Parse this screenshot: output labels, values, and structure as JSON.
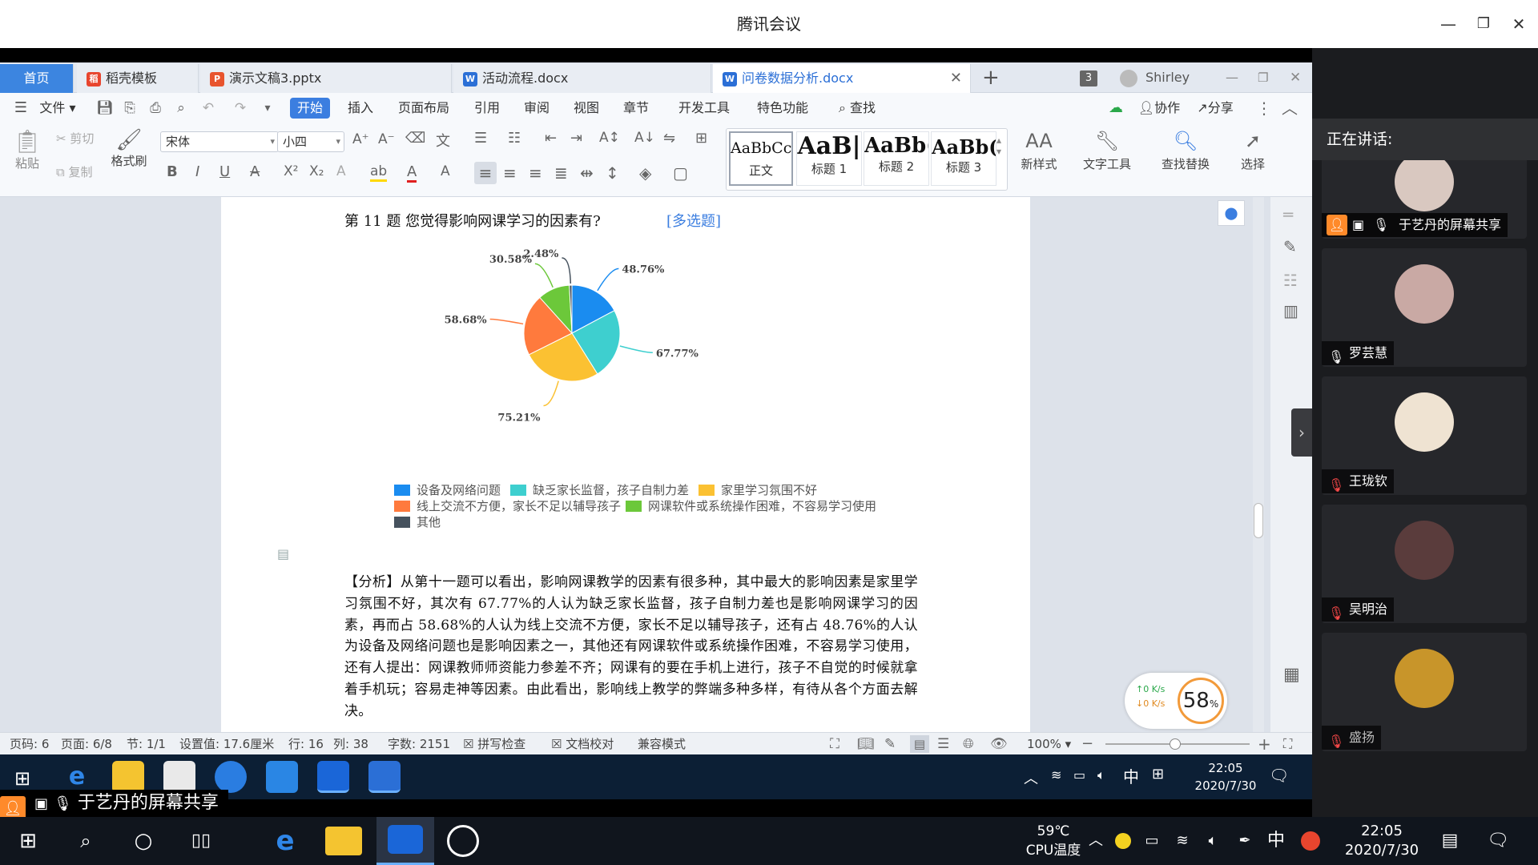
{
  "meeting": {
    "title": "腾讯会议",
    "sharer_label": "于艺丹的屏幕共享",
    "speaking_label": "正在讲话:"
  },
  "wps": {
    "tabs": [
      {
        "label": "首页"
      },
      {
        "label": "稻壳模板",
        "icon": "docer-icon",
        "color": "#e8452e"
      },
      {
        "label": "演示文稿3.pptx",
        "icon": "ppt-icon",
        "color": "#e8542e"
      },
      {
        "label": "活动流程.docx",
        "icon": "word-icon",
        "color": "#2b6fd6"
      },
      {
        "label": "问卷数据分析.docx",
        "icon": "word-icon",
        "color": "#2b6fd6"
      }
    ],
    "tab_count": "3",
    "user": "Shirley",
    "menu": [
      "文件",
      "开始",
      "插入",
      "页面布局",
      "引用",
      "审阅",
      "视图",
      "章节",
      "开发工具",
      "特色功能",
      "查找"
    ],
    "menu_right": [
      "协作",
      "分享"
    ],
    "ribbon": {
      "paste": "粘贴",
      "cut": "剪切",
      "copy": "复制",
      "format_painter": "格式刷",
      "font": "宋体",
      "size": "小四",
      "styles": [
        {
          "sample": "AaBbCcI",
          "label": "正文"
        },
        {
          "sample": "AaB|",
          "label": "标题 1"
        },
        {
          "sample": "AaBb(",
          "label": "标题 2"
        },
        {
          "sample": "AaBb(",
          "label": "标题 3"
        }
      ],
      "new_style": "新样式",
      "text_tool": "文字工具",
      "find_replace": "查找替换",
      "select": "选择"
    },
    "status": {
      "page_code": "页码: 6",
      "page": "页面: 6/8",
      "section": "节: 1/1",
      "setting": "设置值: 17.6厘米",
      "row": "行: 16",
      "col": "列: 38",
      "words": "字数: 2151",
      "spell": "拼写检查",
      "proof": "文档校对",
      "compat": "兼容模式",
      "zoom": "100%"
    },
    "net": {
      "up": "0",
      "down": "0",
      "unit": "K/s",
      "cpu": "58",
      "cpu_unit": "%"
    },
    "inner_clock": {
      "time": "22:05",
      "date": "2020/7/30",
      "ime": "中"
    }
  },
  "doc": {
    "question": "第 11 题   您觉得影响网课学习的因素有?",
    "tag": "[多选题]",
    "paragraph": "【分析】从第十一题可以看出，影响网课教学的因素有很多种，其中最大的影响因素是家里学习氛围不好，其次有 67.77%的人认为缺乏家长监督，孩子自制力差也是影响网课学习的因素，再而占 58.68%的人认为线上交流不方便，家长不足以辅导孩子，还有占 48.76%的人认为设备及网络问题也是影响因素之一，其他还有网课软件或系统操作困难，不容易学习使用，还有人提出：网课教师师资能力参差不齐；网课有的要在手机上进行，孩子不自觉的时候就拿着手机玩；容易走神等因素。由此看出，影响线上教学的弊端多种多样，有待从各个方面去解决。"
  },
  "chart_data": {
    "type": "pie",
    "categories": [
      "设备及网络问题",
      "缺乏家长监督，孩子自制力差",
      "家里学习氛围不好",
      "线上交流不方便，家长不足以辅导孩子",
      "网课软件或系统操作困难，不容易学习使用",
      "其他"
    ],
    "values": [
      48.76,
      67.77,
      75.21,
      58.68,
      30.58,
      2.48
    ],
    "labels": [
      "48.76%",
      "67.77%",
      "75.21%",
      "58.68%",
      "30.58%",
      "2.48%"
    ],
    "colors": [
      "#1a8cf0",
      "#3ecfcf",
      "#fbc132",
      "#ff7a3d",
      "#6cc83a",
      "#46525e"
    ],
    "legend_placement": "bottom"
  },
  "participants": [
    {
      "name": "于艺丹的屏幕共享",
      "avatar": "#d9c8c0",
      "sharing": true
    },
    {
      "name": "罗芸慧",
      "avatar": "#c9a9a4",
      "muted": false
    },
    {
      "name": "王珑钦",
      "avatar": "#efe3d2",
      "muted": true
    },
    {
      "name": "吴明治",
      "avatar": "#5a3c3c",
      "muted": true
    },
    {
      "name": "盛扬",
      "avatar": "#c8952a",
      "muted": true
    }
  ],
  "taskbar": {
    "temp": "59℃",
    "temp_label": "CPU温度",
    "ime": "中",
    "time": "22:05",
    "date": "2020/7/30"
  }
}
